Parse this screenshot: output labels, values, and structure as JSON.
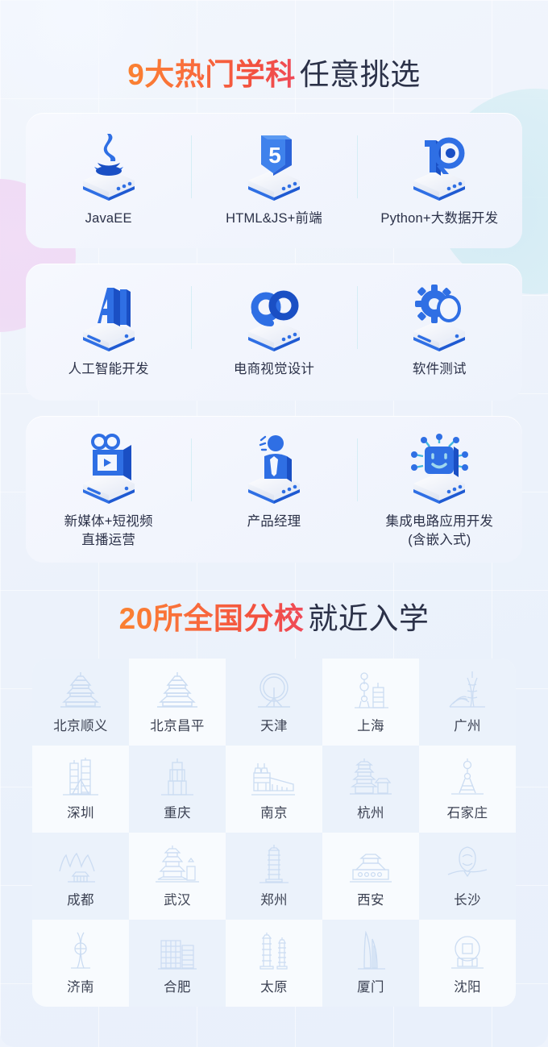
{
  "headings": {
    "subjects": {
      "accent": "9大热门学科",
      "plain": "任意挑选"
    },
    "campuses": {
      "accent": "20所全国分校",
      "plain": "就近入学"
    }
  },
  "colors": {
    "accent_start": "#fa8231",
    "accent_end": "#ef4a5a",
    "heading_plain": "#2b3148",
    "card_bg": "#f4f6fd",
    "divider": "#d5eef5",
    "cell_bg_light": "#f8fbfe",
    "cell_bg_alt": "#ebf2fb",
    "icon_blue": "#2f6fe4",
    "icon_blue_dark": "#1a4fc4",
    "page_bg": "#eef3fc"
  },
  "subjects": {
    "rows": [
      {
        "items": [
          {
            "label": "JavaEE",
            "icon": "java-icon"
          },
          {
            "label": "HTML&JS+前端",
            "icon": "html5-icon"
          },
          {
            "label": "Python+大数据开发",
            "icon": "python-bigdata-icon"
          }
        ]
      },
      {
        "items": [
          {
            "label": "人工智能开发",
            "icon": "ai-icon"
          },
          {
            "label": "电商视觉设计",
            "icon": "ecommerce-design-icon"
          },
          {
            "label": "软件测试",
            "icon": "software-testing-icon"
          }
        ]
      },
      {
        "items": [
          {
            "label": "新媒体+短视频\n直播运营",
            "icon": "new-media-video-icon"
          },
          {
            "label": "产品经理",
            "icon": "product-manager-icon"
          },
          {
            "label": "集成电路应用开发\n(含嵌入式)",
            "icon": "integrated-circuit-icon"
          }
        ]
      }
    ]
  },
  "cities": [
    {
      "label": "北京顺义",
      "icon": "temple-of-heaven-icon",
      "alt": true
    },
    {
      "label": "北京昌平",
      "icon": "temple-of-heaven-icon",
      "alt": false
    },
    {
      "label": "天津",
      "icon": "tianjin-eye-icon",
      "alt": true
    },
    {
      "label": "上海",
      "icon": "oriental-pearl-icon",
      "alt": false
    },
    {
      "label": "广州",
      "icon": "canton-tower-icon",
      "alt": true
    },
    {
      "label": "深圳",
      "icon": "shenzhen-towers-icon",
      "alt": false
    },
    {
      "label": "重庆",
      "icon": "chongqing-tower-icon",
      "alt": true
    },
    {
      "label": "南京",
      "icon": "nanjing-gate-icon",
      "alt": false
    },
    {
      "label": "杭州",
      "icon": "hangzhou-pagoda-icon",
      "alt": true
    },
    {
      "label": "石家庄",
      "icon": "shijiazhuang-tower-icon",
      "alt": false
    },
    {
      "label": "成都",
      "icon": "chengdu-mountains-icon",
      "alt": true
    },
    {
      "label": "武汉",
      "icon": "yellow-crane-tower-icon",
      "alt": false
    },
    {
      "label": "郑州",
      "icon": "zhengzhou-pagoda-icon",
      "alt": true
    },
    {
      "label": "西安",
      "icon": "xian-bell-tower-icon",
      "alt": false
    },
    {
      "label": "长沙",
      "icon": "changsha-orange-isle-icon",
      "alt": true
    },
    {
      "label": "济南",
      "icon": "jinan-tower-icon",
      "alt": false
    },
    {
      "label": "合肥",
      "icon": "hefei-buildings-icon",
      "alt": true
    },
    {
      "label": "太原",
      "icon": "taiyuan-twin-pagodas-icon",
      "alt": false
    },
    {
      "label": "厦门",
      "icon": "xiamen-tower-icon",
      "alt": true
    },
    {
      "label": "沈阳",
      "icon": "shenyang-station-icon",
      "alt": false
    }
  ]
}
